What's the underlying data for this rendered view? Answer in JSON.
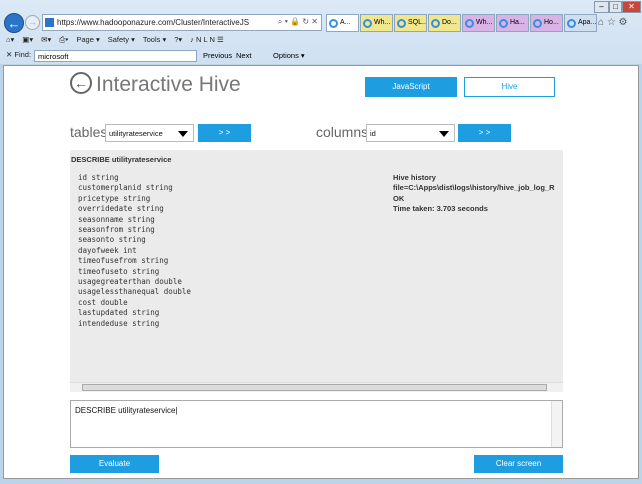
{
  "browser": {
    "url": "https://www.hadooponazure.com/Cluster/InteractiveJS",
    "tabs": [
      "A...",
      "Wh...",
      "SQL...",
      "Do...",
      "Wh...",
      "Ha...",
      "Ho...",
      "Apa..."
    ],
    "tab_colors": [
      "#ffffff",
      "#f0e68c",
      "#f0e68c",
      "#f0e68c",
      "#d9b3e6",
      "#d9b3e6",
      "#d9b3e6",
      "#d0dff0"
    ],
    "toolbar": {
      "page": "Page ▾",
      "safety": "Safety ▾",
      "tools": "Tools ▾"
    },
    "find": {
      "label": "Find:",
      "value": "microsoft",
      "previous": "Previous",
      "next": "Next",
      "options": "Options ▾"
    }
  },
  "page": {
    "title": "Interactive Hive",
    "javascript_button": "JavaScript",
    "hive_button": "Hive",
    "tables_label": "tables",
    "tables_value": "utilityrateservice",
    "columns_label": "columns",
    "columns_value": "id",
    "go_label": "> >",
    "query_header": "DESCRIBE utilityrateservice",
    "schema": [
      "id string",
      "customerplanid string",
      "pricetype string",
      "overridedate string",
      "seasonname string",
      "seasonfrom string",
      "seasonto string",
      "dayofweek int",
      "timeofusefrom string",
      "timeofuseto string",
      "usagegreaterthan double",
      "usagelessthanequal double",
      "cost double",
      "lastupdated string",
      "intendeduse string"
    ],
    "history": [
      "Hive history",
      "file=C:\\Apps\\dist\\logs\\history/hive_job_log_R",
      "OK",
      "Time taken: 3.703 seconds"
    ],
    "query_input": "DESCRIBE utilityrateservice",
    "evaluate_button": "Evaluate",
    "clear_button": "Clear screen",
    "accent": "#1e9ee0"
  }
}
